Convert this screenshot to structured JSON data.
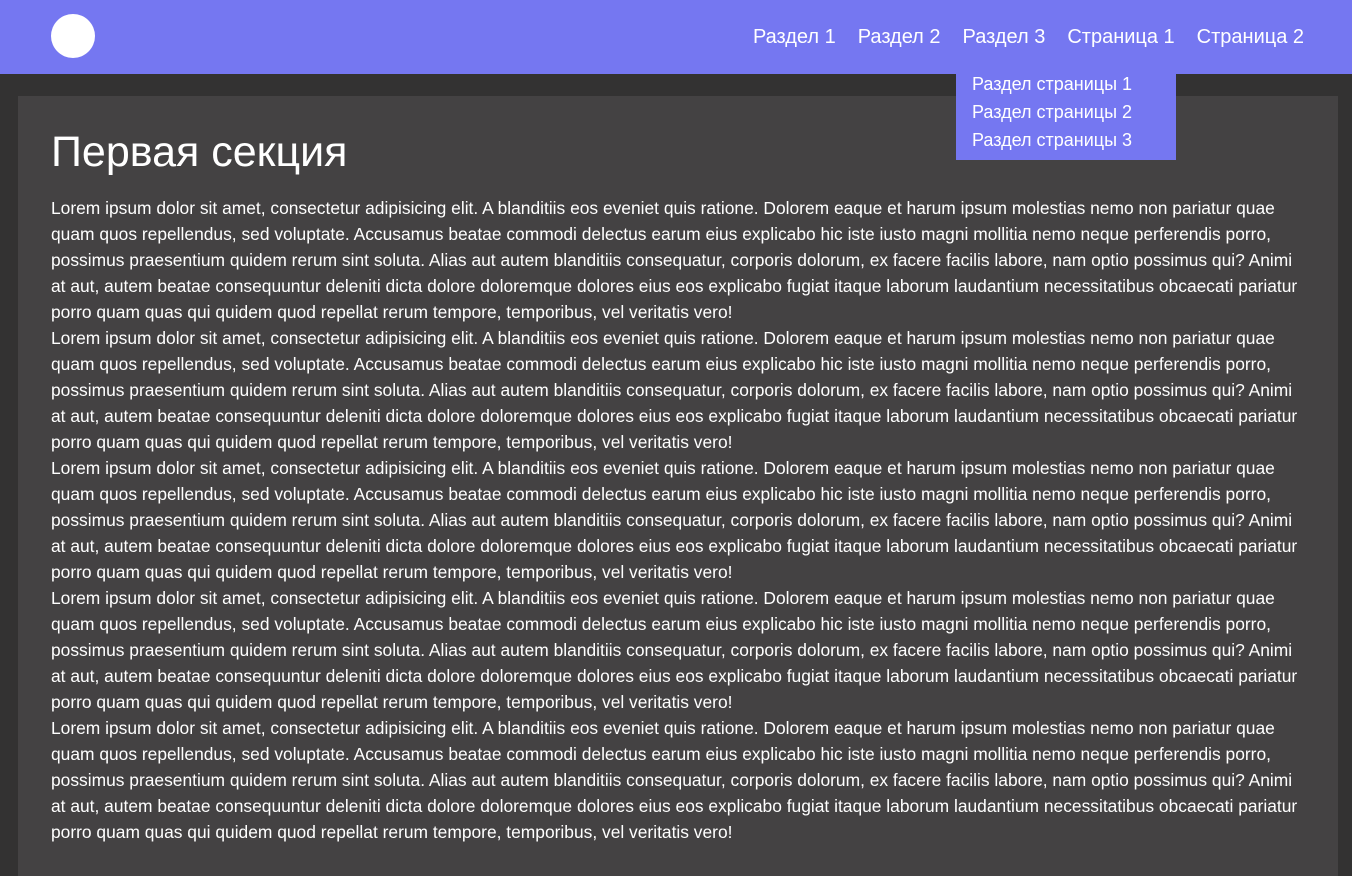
{
  "header": {
    "nav": [
      {
        "label": "Раздел 1"
      },
      {
        "label": "Раздел 2"
      },
      {
        "label": "Раздел 3"
      },
      {
        "label": "Страница 1"
      },
      {
        "label": "Страница 2"
      }
    ],
    "dropdown": [
      {
        "label": "Раздел страницы 1"
      },
      {
        "label": "Раздел страницы 2"
      },
      {
        "label": "Раздел страницы 3"
      }
    ]
  },
  "section": {
    "title": "Первая секция",
    "paragraphs": [
      "Lorem ipsum dolor sit amet, consectetur adipisicing elit. A blanditiis eos eveniet quis ratione. Dolorem eaque et harum ipsum molestias nemo non pariatur quae quam quos repellendus, sed voluptate. Accusamus beatae commodi delectus earum eius explicabo hic iste iusto magni mollitia nemo neque perferendis porro, possimus praesentium quidem rerum sint soluta. Alias aut autem blanditiis consequatur, corporis dolorum, ex facere facilis labore, nam optio possimus qui? Animi at aut, autem beatae consequuntur deleniti dicta dolore doloremque dolores eius eos explicabo fugiat itaque laborum laudantium necessitatibus obcaecati pariatur porro quam quas qui quidem quod repellat rerum tempore, temporibus, vel veritatis vero!",
      "Lorem ipsum dolor sit amet, consectetur adipisicing elit. A blanditiis eos eveniet quis ratione. Dolorem eaque et harum ipsum molestias nemo non pariatur quae quam quos repellendus, sed voluptate. Accusamus beatae commodi delectus earum eius explicabo hic iste iusto magni mollitia nemo neque perferendis porro, possimus praesentium quidem rerum sint soluta. Alias aut autem blanditiis consequatur, corporis dolorum, ex facere facilis labore, nam optio possimus qui? Animi at aut, autem beatae consequuntur deleniti dicta dolore doloremque dolores eius eos explicabo fugiat itaque laborum laudantium necessitatibus obcaecati pariatur porro quam quas qui quidem quod repellat rerum tempore, temporibus, vel veritatis vero!",
      "Lorem ipsum dolor sit amet, consectetur adipisicing elit. A blanditiis eos eveniet quis ratione. Dolorem eaque et harum ipsum molestias nemo non pariatur quae quam quos repellendus, sed voluptate. Accusamus beatae commodi delectus earum eius explicabo hic iste iusto magni mollitia nemo neque perferendis porro, possimus praesentium quidem rerum sint soluta. Alias aut autem blanditiis consequatur, corporis dolorum, ex facere facilis labore, nam optio possimus qui? Animi at aut, autem beatae consequuntur deleniti dicta dolore doloremque dolores eius eos explicabo fugiat itaque laborum laudantium necessitatibus obcaecati pariatur porro quam quas qui quidem quod repellat rerum tempore, temporibus, vel veritatis vero!",
      "Lorem ipsum dolor sit amet, consectetur adipisicing elit. A blanditiis eos eveniet quis ratione. Dolorem eaque et harum ipsum molestias nemo non pariatur quae quam quos repellendus, sed voluptate. Accusamus beatae commodi delectus earum eius explicabo hic iste iusto magni mollitia nemo neque perferendis porro, possimus praesentium quidem rerum sint soluta. Alias aut autem blanditiis consequatur, corporis dolorum, ex facere facilis labore, nam optio possimus qui? Animi at aut, autem beatae consequuntur deleniti dicta dolore doloremque dolores eius eos explicabo fugiat itaque laborum laudantium necessitatibus obcaecati pariatur porro quam quas qui quidem quod repellat rerum tempore, temporibus, vel veritatis vero!",
      "Lorem ipsum dolor sit amet, consectetur adipisicing elit. A blanditiis eos eveniet quis ratione. Dolorem eaque et harum ipsum molestias nemo non pariatur quae quam quos repellendus, sed voluptate. Accusamus beatae commodi delectus earum eius explicabo hic iste iusto magni mollitia nemo neque perferendis porro, possimus praesentium quidem rerum sint soluta. Alias aut autem blanditiis consequatur, corporis dolorum, ex facere facilis labore, nam optio possimus qui? Animi at aut, autem beatae consequuntur deleniti dicta dolore doloremque dolores eius eos explicabo fugiat itaque laborum laudantium necessitatibus obcaecati pariatur porro quam quas qui quidem quod repellat rerum tempore, temporibus, vel veritatis vero!"
    ]
  },
  "colors": {
    "header_bg": "#7577f1",
    "page_bg": "#333232",
    "section_bg": "#444243",
    "text": "#ffffff"
  }
}
